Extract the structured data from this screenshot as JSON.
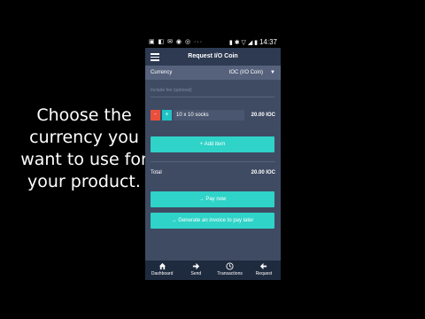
{
  "caption": "Choose the currency you want to use for your product.",
  "status": {
    "left_icons": "▣ ◧ ✉ ◉ ◎ ···",
    "right_icons": "▮ ✱ ▽ ◢ ▮",
    "time": "14:37"
  },
  "appbar": {
    "title": "Request I/O Coin",
    "menu_icon": "hamburger-icon"
  },
  "currency": {
    "label": "Currency",
    "value": "IOC (I/O Coin)",
    "caret": "▼"
  },
  "field": {
    "placeholder": "Include fee (optional)"
  },
  "item": {
    "minus": "-",
    "plus": "+",
    "name": "10 x 10 socks",
    "price": "20.00 IOC"
  },
  "add_item_label": "+ Add item",
  "total": {
    "label": "Total",
    "value": "20.00 IOC"
  },
  "pay_now_label": "→ Pay now",
  "invoice_label": "→ Generate an invoice to pay later",
  "nav": [
    {
      "label": "Dashboard",
      "icon": "home-icon"
    },
    {
      "label": "Send",
      "icon": "arrow-right-icon"
    },
    {
      "label": "Transactions",
      "icon": "clock-icon"
    },
    {
      "label": "Request",
      "icon": "arrow-left-icon"
    }
  ],
  "colors": {
    "accent": "#2fd3c8",
    "minus": "#e9503c",
    "plus": "#1fc3c4",
    "background": "#3f4b63",
    "appbar": "#2d3a52"
  }
}
